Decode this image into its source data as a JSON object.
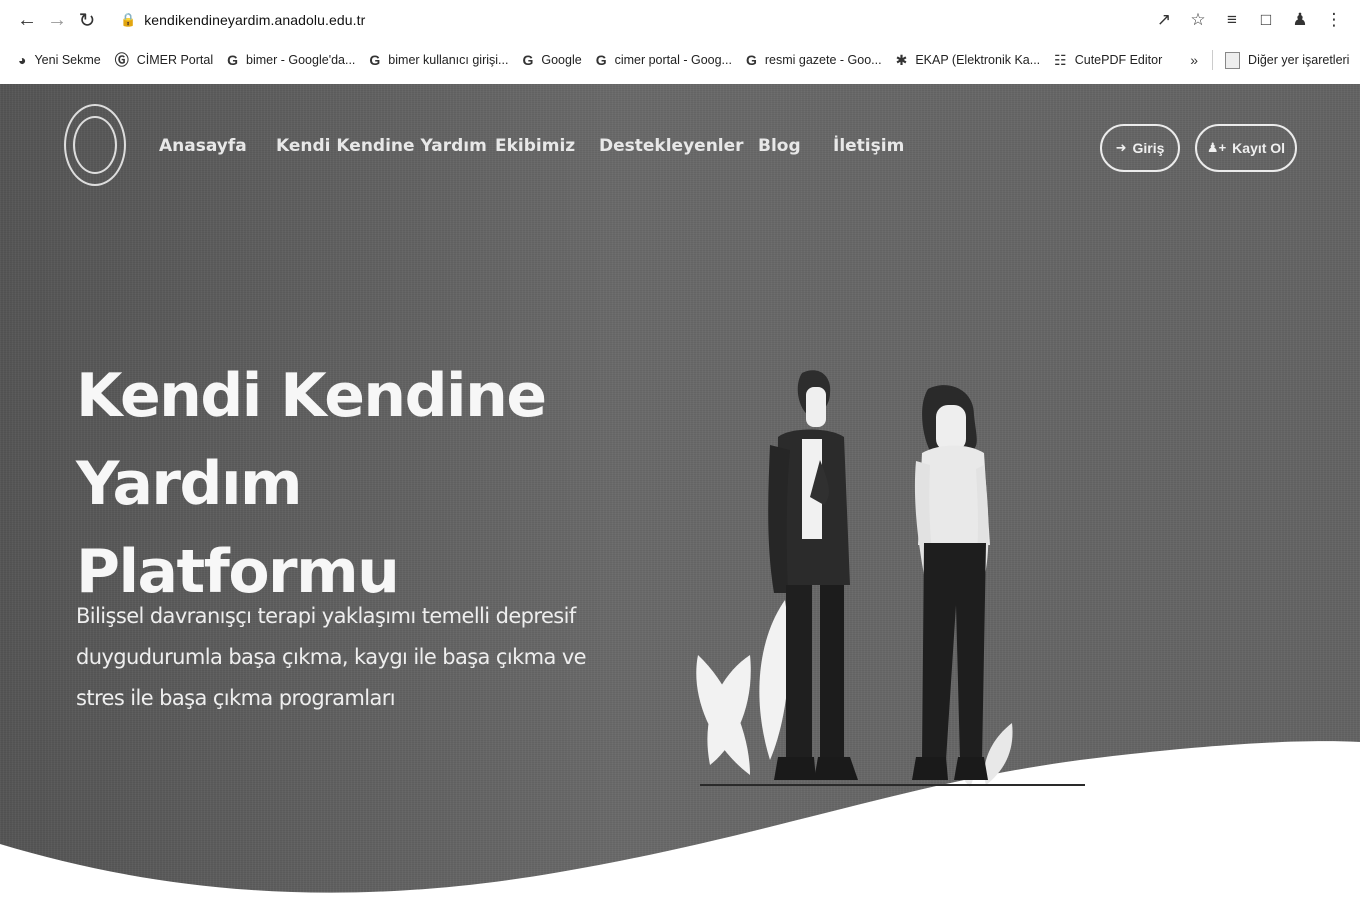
{
  "browser": {
    "url": "kendikendineyardim.anadolu.edu.tr",
    "bookmarks": [
      {
        "label": "Yeni Sekme",
        "icon": "globe-icon",
        "glyph": "◕"
      },
      {
        "label": "CİMER Portal",
        "icon": "cimer-icon",
        "glyph": "Ⓖ"
      },
      {
        "label": "bimer - Google'da...",
        "icon": "google-icon",
        "glyph": "G"
      },
      {
        "label": "bimer kullanıcı girişi...",
        "icon": "google-icon",
        "glyph": "G"
      },
      {
        "label": "Google",
        "icon": "google-icon",
        "glyph": "G"
      },
      {
        "label": "cimer portal - Goog...",
        "icon": "google-icon",
        "glyph": "G"
      },
      {
        "label": "resmi gazete - Goo...",
        "icon": "google-icon",
        "glyph": "G"
      },
      {
        "label": "EKAP (Elektronik Ka...",
        "icon": "ekap-icon",
        "glyph": "✱"
      },
      {
        "label": "CutePDF Editor",
        "icon": "pdf-icon",
        "glyph": "☷"
      }
    ],
    "more_label": "»",
    "other_bookmarks": "Diğer yer işaretleri"
  },
  "site": {
    "nav": [
      {
        "label": "Anasayfa"
      },
      {
        "label": "Kendi Kendine Yardım"
      },
      {
        "label": "Ekibimiz"
      },
      {
        "label": "Destekleyenler"
      },
      {
        "label": "Blog"
      },
      {
        "label": "İletişim"
      }
    ],
    "login_label": "Giriş",
    "register_label": "Kayıt Ol"
  },
  "hero": {
    "title_line1": "Kendi Kendine",
    "title_line2": "Yardım Platformu",
    "subtitle_line1": "Bilişsel davranışçı terapi yaklaşımı temelli depresif",
    "subtitle_line2": "duygudurumla başa çıkma, kaygı ile başa çıkma ve",
    "subtitle_line3": "stres ile başa çıkma programları"
  }
}
